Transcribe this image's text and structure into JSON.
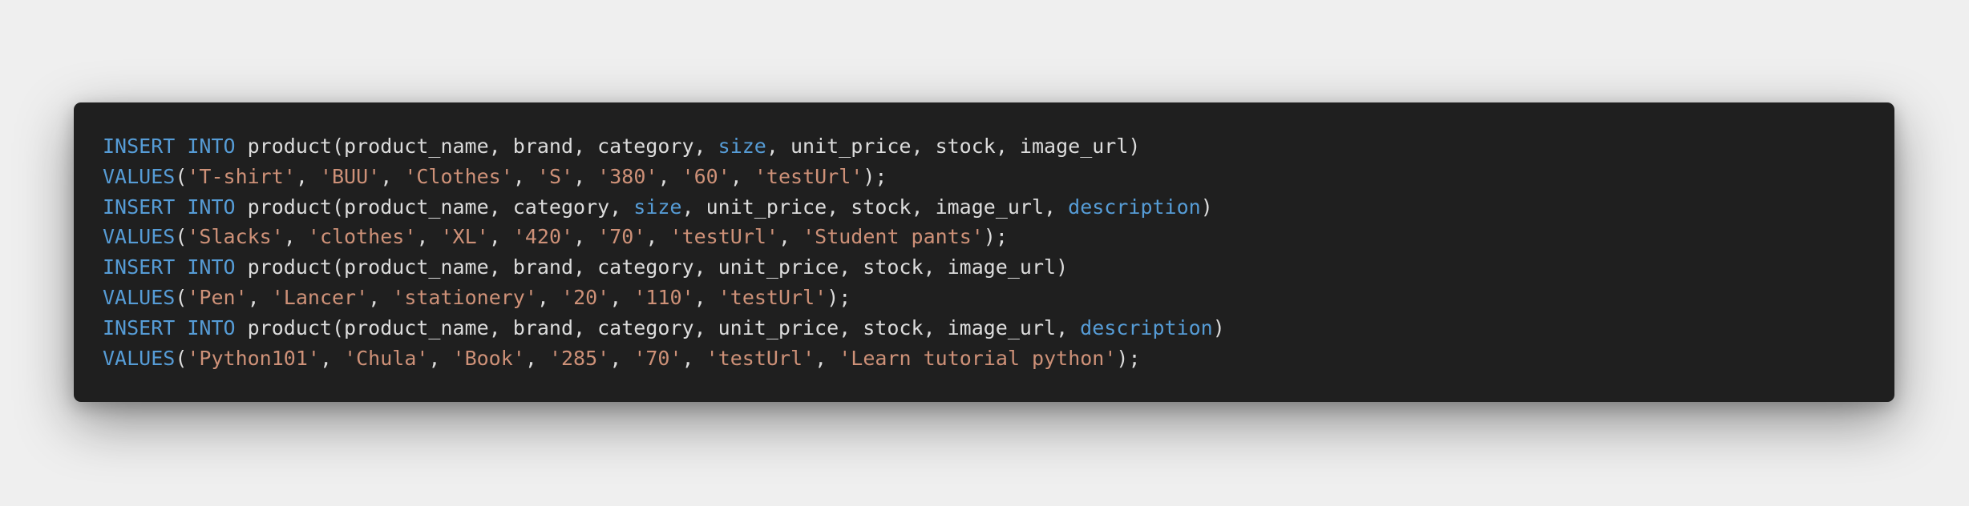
{
  "code_block": {
    "language": "sql",
    "colors": {
      "background": "#1f1f1f",
      "page_background": "#efefef",
      "keyword": "#569cd6",
      "string": "#ce9178",
      "plain": "#dcdcdc"
    },
    "lines": [
      [
        {
          "t": "kw",
          "v": "INSERT INTO"
        },
        {
          "t": "plain",
          "v": " product(product_name, brand, category, "
        },
        {
          "t": "kw",
          "v": "size"
        },
        {
          "t": "plain",
          "v": ", unit_price, stock, image_url)"
        }
      ],
      [
        {
          "t": "kw",
          "v": "VALUES"
        },
        {
          "t": "plain",
          "v": "("
        },
        {
          "t": "str",
          "v": "'T-shirt'"
        },
        {
          "t": "plain",
          "v": ", "
        },
        {
          "t": "str",
          "v": "'BUU'"
        },
        {
          "t": "plain",
          "v": ", "
        },
        {
          "t": "str",
          "v": "'Clothes'"
        },
        {
          "t": "plain",
          "v": ", "
        },
        {
          "t": "str",
          "v": "'S'"
        },
        {
          "t": "plain",
          "v": ", "
        },
        {
          "t": "str",
          "v": "'380'"
        },
        {
          "t": "plain",
          "v": ", "
        },
        {
          "t": "str",
          "v": "'60'"
        },
        {
          "t": "plain",
          "v": ", "
        },
        {
          "t": "str",
          "v": "'testUrl'"
        },
        {
          "t": "plain",
          "v": ");"
        }
      ],
      [
        {
          "t": "kw",
          "v": "INSERT INTO"
        },
        {
          "t": "plain",
          "v": " product(product_name, category, "
        },
        {
          "t": "kw",
          "v": "size"
        },
        {
          "t": "plain",
          "v": ", unit_price, stock, image_url, "
        },
        {
          "t": "kw",
          "v": "description"
        },
        {
          "t": "plain",
          "v": ")"
        }
      ],
      [
        {
          "t": "kw",
          "v": "VALUES"
        },
        {
          "t": "plain",
          "v": "("
        },
        {
          "t": "str",
          "v": "'Slacks'"
        },
        {
          "t": "plain",
          "v": ", "
        },
        {
          "t": "str",
          "v": "'clothes'"
        },
        {
          "t": "plain",
          "v": ", "
        },
        {
          "t": "str",
          "v": "'XL'"
        },
        {
          "t": "plain",
          "v": ", "
        },
        {
          "t": "str",
          "v": "'420'"
        },
        {
          "t": "plain",
          "v": ", "
        },
        {
          "t": "str",
          "v": "'70'"
        },
        {
          "t": "plain",
          "v": ", "
        },
        {
          "t": "str",
          "v": "'testUrl'"
        },
        {
          "t": "plain",
          "v": ", "
        },
        {
          "t": "str",
          "v": "'Student pants'"
        },
        {
          "t": "plain",
          "v": ");"
        }
      ],
      [
        {
          "t": "kw",
          "v": "INSERT INTO"
        },
        {
          "t": "plain",
          "v": " product(product_name, brand, category, unit_price, stock, image_url)"
        }
      ],
      [
        {
          "t": "kw",
          "v": "VALUES"
        },
        {
          "t": "plain",
          "v": "("
        },
        {
          "t": "str",
          "v": "'Pen'"
        },
        {
          "t": "plain",
          "v": ", "
        },
        {
          "t": "str",
          "v": "'Lancer'"
        },
        {
          "t": "plain",
          "v": ", "
        },
        {
          "t": "str",
          "v": "'stationery'"
        },
        {
          "t": "plain",
          "v": ", "
        },
        {
          "t": "str",
          "v": "'20'"
        },
        {
          "t": "plain",
          "v": ", "
        },
        {
          "t": "str",
          "v": "'110'"
        },
        {
          "t": "plain",
          "v": ", "
        },
        {
          "t": "str",
          "v": "'testUrl'"
        },
        {
          "t": "plain",
          "v": ");"
        }
      ],
      [
        {
          "t": "kw",
          "v": "INSERT INTO"
        },
        {
          "t": "plain",
          "v": " product(product_name, brand, category, unit_price, stock, image_url, "
        },
        {
          "t": "kw",
          "v": "description"
        },
        {
          "t": "plain",
          "v": ")"
        }
      ],
      [
        {
          "t": "kw",
          "v": "VALUES"
        },
        {
          "t": "plain",
          "v": "("
        },
        {
          "t": "str",
          "v": "'Python101'"
        },
        {
          "t": "plain",
          "v": ", "
        },
        {
          "t": "str",
          "v": "'Chula'"
        },
        {
          "t": "plain",
          "v": ", "
        },
        {
          "t": "str",
          "v": "'Book'"
        },
        {
          "t": "plain",
          "v": ", "
        },
        {
          "t": "str",
          "v": "'285'"
        },
        {
          "t": "plain",
          "v": ", "
        },
        {
          "t": "str",
          "v": "'70'"
        },
        {
          "t": "plain",
          "v": ", "
        },
        {
          "t": "str",
          "v": "'testUrl'"
        },
        {
          "t": "plain",
          "v": ", "
        },
        {
          "t": "str",
          "v": "'Learn tutorial python'"
        },
        {
          "t": "plain",
          "v": ");"
        }
      ]
    ]
  }
}
